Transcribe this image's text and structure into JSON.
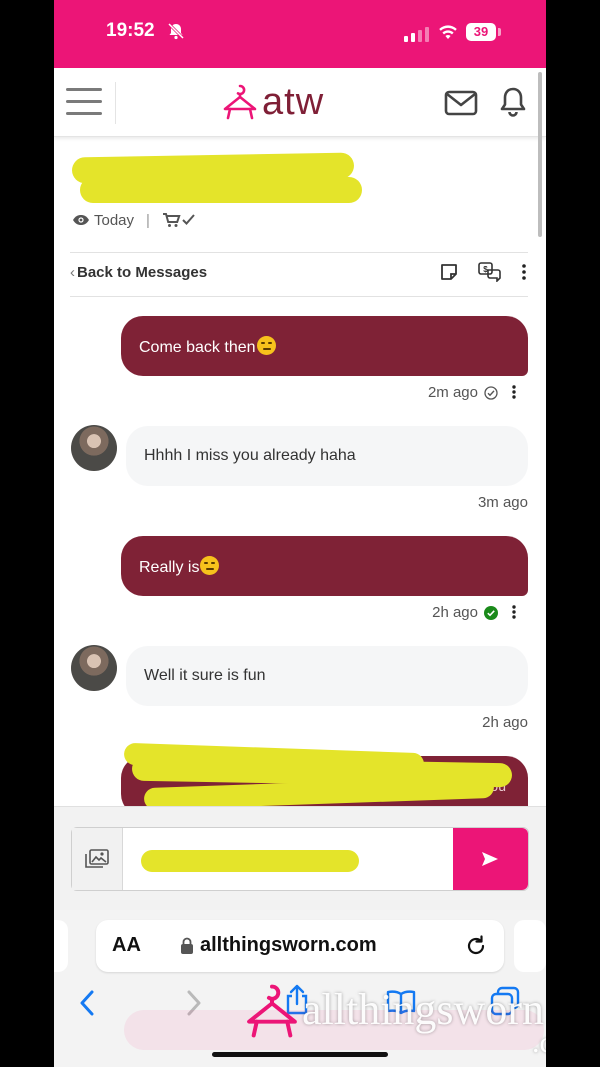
{
  "status_bar": {
    "time": "19:52",
    "battery": "39"
  },
  "header": {
    "brand": "atw"
  },
  "profile": {
    "last_seen": "Today"
  },
  "toolbar": {
    "back_label": "Back to Messages"
  },
  "messages": [
    {
      "direction": "out",
      "text": "Come back then",
      "emoji": "unamused-face-emoji",
      "time": "2m ago",
      "status": "sent"
    },
    {
      "direction": "in",
      "text": "Hhhh I miss you already haha",
      "time": "3m ago"
    },
    {
      "direction": "out",
      "text": "Really is",
      "emoji": "unamused-face-emoji",
      "time": "2h ago",
      "status": "read"
    },
    {
      "direction": "in",
      "text": "Well it sure is fun",
      "time": "2h ago"
    },
    {
      "direction": "out",
      "text": "ou",
      "redacted": true
    }
  ],
  "browser": {
    "aa_label": "AA",
    "url": "allthingsworn.com"
  },
  "watermark": {
    "main": "allthingsworn",
    "suffix": ".com"
  },
  "colors": {
    "brand_pink": "#ec1577",
    "bubble_out": "#7f2236",
    "highlight_redaction": "#e4e42a",
    "read_check": "#1a8a1a"
  }
}
